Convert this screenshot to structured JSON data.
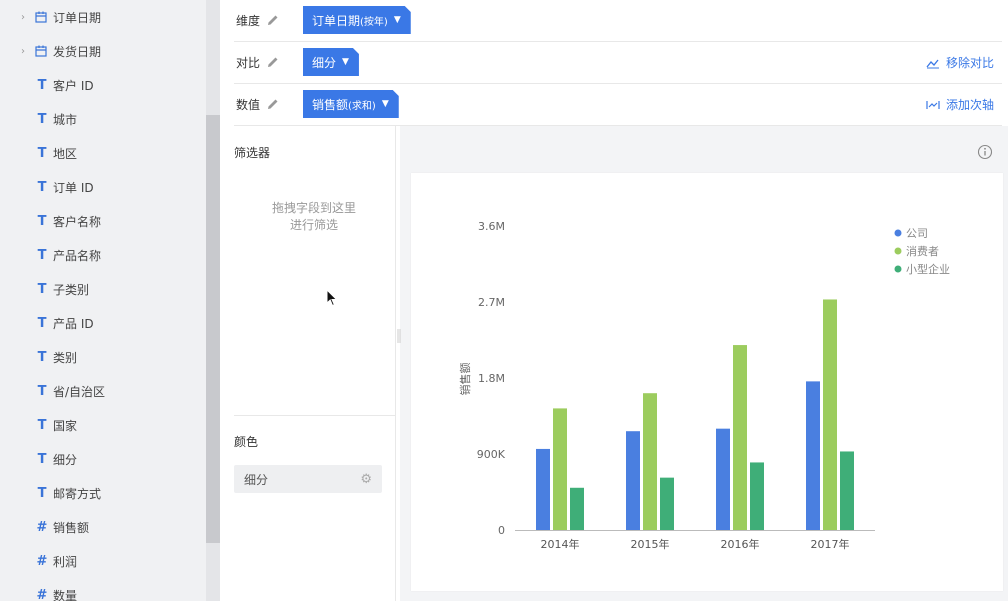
{
  "fields": [
    {
      "type": "date",
      "name": "订单日期",
      "expandable": true
    },
    {
      "type": "date",
      "name": "发货日期",
      "expandable": true
    },
    {
      "type": "text",
      "name": "客户 ID"
    },
    {
      "type": "text",
      "name": "城市"
    },
    {
      "type": "text",
      "name": "地区"
    },
    {
      "type": "text",
      "name": "订单 ID"
    },
    {
      "type": "text",
      "name": "客户名称"
    },
    {
      "type": "text",
      "name": "产品名称"
    },
    {
      "type": "text",
      "name": "子类别"
    },
    {
      "type": "text",
      "name": "产品 ID"
    },
    {
      "type": "text",
      "name": "类别"
    },
    {
      "type": "text",
      "name": "省/自治区"
    },
    {
      "type": "text",
      "name": "国家"
    },
    {
      "type": "text",
      "name": "细分"
    },
    {
      "type": "text",
      "name": "邮寄方式"
    },
    {
      "type": "number",
      "name": "销售额"
    },
    {
      "type": "number",
      "name": "利润"
    },
    {
      "type": "number",
      "name": "数量"
    }
  ],
  "shelves": {
    "dimension": {
      "label": "维度",
      "pill": "订单日期",
      "pill_suffix": "(按年)"
    },
    "compare": {
      "label": "对比",
      "pill": "细分",
      "action": "移除对比"
    },
    "value": {
      "label": "数值",
      "pill": "销售额",
      "pill_suffix": "(求和)",
      "action": "添加次轴"
    }
  },
  "filter": {
    "title": "筛选器",
    "hint_line1": "拖拽字段到这里",
    "hint_line2": "进行筛选"
  },
  "color": {
    "title": "颜色",
    "field": "细分"
  },
  "colors": {
    "accent": "#3a78e6",
    "company": "#4a7fe0",
    "consumer": "#9ccc5e",
    "small_business": "#3fae78"
  },
  "chart_data": {
    "type": "bar",
    "categories": [
      "2014年",
      "2015年",
      "2016年",
      "2017年"
    ],
    "series": [
      {
        "name": "公司",
        "color": "#4a7fe0",
        "values": [
          960000,
          1170000,
          1200000,
          1760000
        ]
      },
      {
        "name": "消费者",
        "color": "#9ccc5e",
        "values": [
          1440000,
          1620000,
          2190000,
          2730000
        ]
      },
      {
        "name": "小型企业",
        "color": "#3fae78",
        "values": [
          500000,
          620000,
          800000,
          930000
        ]
      }
    ],
    "yticks": [
      0,
      900000,
      1800000,
      2700000,
      3600000
    ],
    "ytick_labels": [
      "0",
      "900K",
      "1.8M",
      "2.7M",
      "3.6M"
    ],
    "ylim": [
      0,
      3600000
    ],
    "ylabel": "销售额",
    "xlabel": "",
    "legend": "top-right",
    "grid": false
  }
}
